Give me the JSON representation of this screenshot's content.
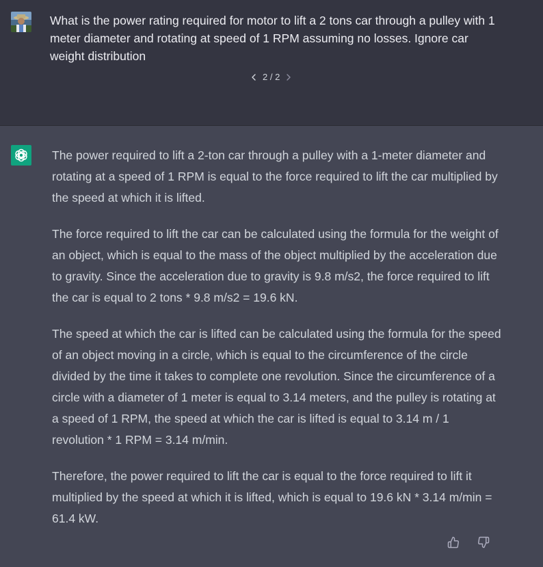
{
  "user_message": {
    "avatar_icon": "user-avatar-photo",
    "text": "What is the power rating required for motor to lift a 2 tons car through a pulley with 1 meter diameter and rotating at speed of 1 RPM assuming no losses. Ignore car weight distribution",
    "pager": {
      "label": "2 / 2",
      "prev_icon": "chevron-left-icon",
      "next_icon": "chevron-right-icon"
    }
  },
  "assistant_message": {
    "avatar_icon": "openai-logo-icon",
    "avatar_color": "#10a37f",
    "paragraphs": [
      "The power required to lift a 2-ton car through a pulley with a 1-meter diameter and rotating at a speed of 1 RPM is equal to the force required to lift the car multiplied by the speed at which it is lifted.",
      "The force required to lift the car can be calculated using the formula for the weight of an object, which is equal to the mass of the object multiplied by the acceleration due to gravity. Since the acceleration due to gravity is 9.8 m/s2, the force required to lift the car is equal to 2 tons * 9.8 m/s2 = 19.6 kN.",
      "The speed at which the car is lifted can be calculated using the formula for the speed of an object moving in a circle, which is equal to the circumference of the circle divided by the time it takes to complete one revolution. Since the circumference of a circle with a diameter of 1 meter is equal to 3.14 meters, and the pulley is rotating at a speed of 1 RPM, the speed at which the car is lifted is equal to 3.14 m / 1 revolution * 1 RPM = 3.14 m/min.",
      "Therefore, the power required to lift the car is equal to the force required to lift it multiplied by the speed at which it is lifted, which is equal to 19.6 kN * 3.14 m/min = 61.4 kW."
    ],
    "feedback": {
      "thumbs_up_icon": "thumbs-up-icon",
      "thumbs_down_icon": "thumbs-down-icon"
    }
  },
  "colors": {
    "user_bg": "#343541",
    "assistant_bg": "#444654",
    "text_primary": "#ececf1",
    "text_secondary": "#d1d5db"
  }
}
